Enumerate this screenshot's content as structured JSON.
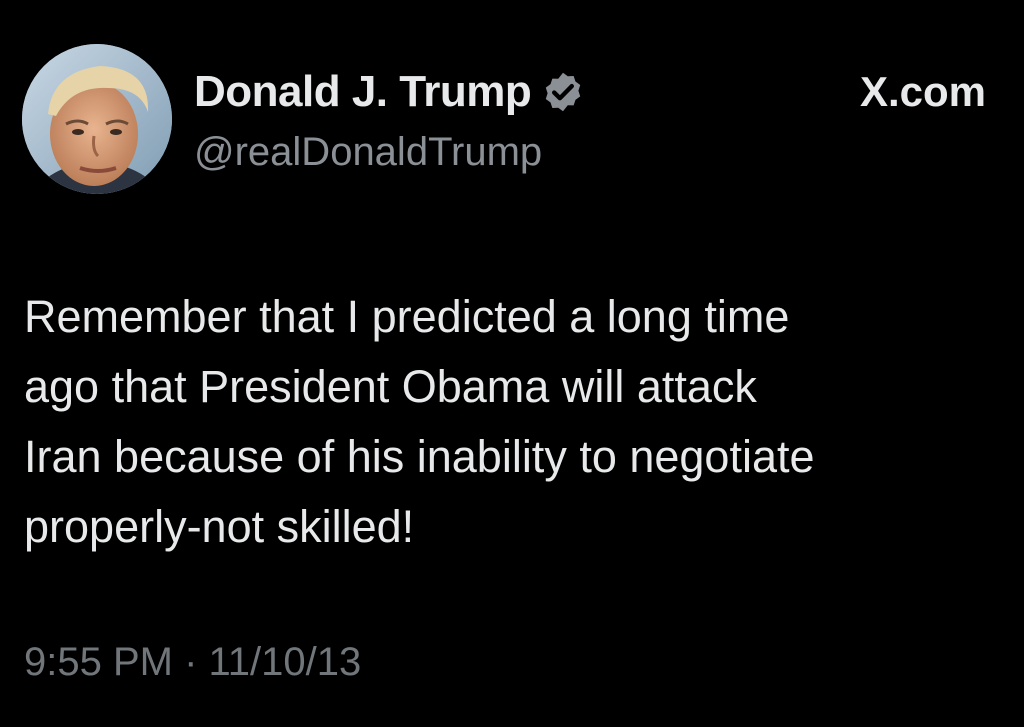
{
  "author": {
    "display_name": "Donald J. Trump",
    "handle": "@realDonaldTrump",
    "verified": true,
    "verified_badge_color": "#8b9096"
  },
  "brand": {
    "label": "X.com"
  },
  "tweet": {
    "lines": [
      "Remember that I predicted a long time",
      "ago that President Obama will attack",
      "Iran because of his inability to negotiate",
      "properly-not skilled!"
    ],
    "timestamp": "9:55 PM · 11/10/13"
  },
  "colors": {
    "background": "#000000",
    "primary_text": "#e7e9ea",
    "secondary_text": "#71767b"
  }
}
